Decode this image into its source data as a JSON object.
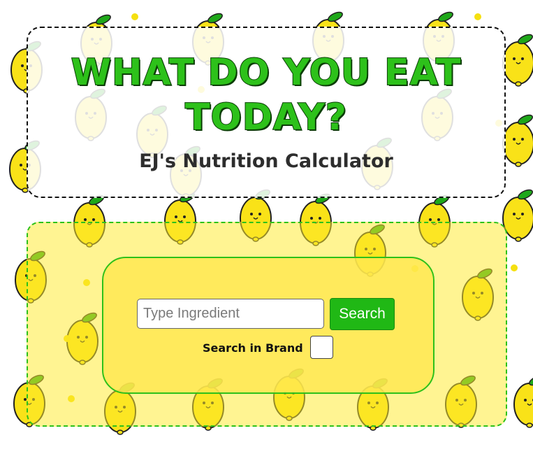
{
  "header": {
    "title_line1": "WHAT DO YOU EAT",
    "title_line2": "TODAY?",
    "subtitle": "EJ's Nutrition Calculator"
  },
  "search": {
    "placeholder": "Type Ingredient",
    "value": "",
    "button_label": "Search",
    "brand_label": "Search in Brand",
    "brand_checked": false
  },
  "colors": {
    "title_green": "#2dc11a",
    "title_outline": "#0a3d05",
    "accent_green": "#20b815",
    "panel_yellow": "#ffea2e",
    "lemon_yellow": "#f9e218",
    "leaf_green": "#1fa81a"
  },
  "background": {
    "pattern_icon": "lemon-icon"
  }
}
